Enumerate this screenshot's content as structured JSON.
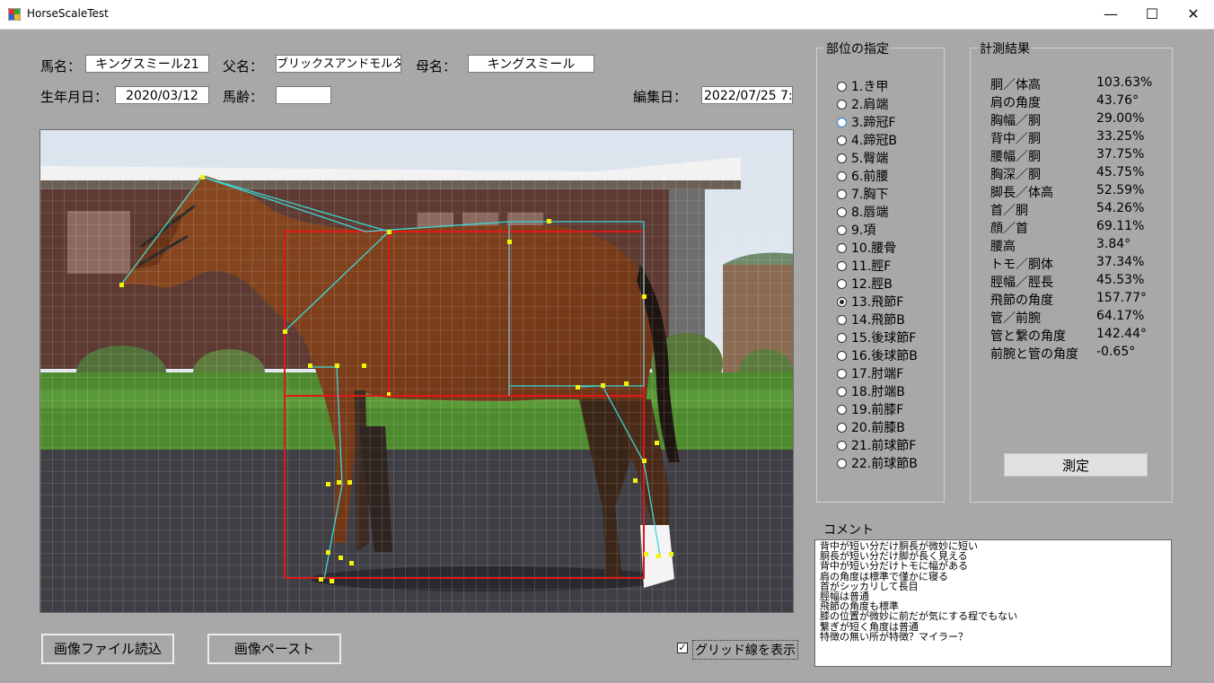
{
  "window": {
    "title": "HorseScaleTest",
    "minimize": "—",
    "maximize": "☐",
    "close": "✕"
  },
  "header": {
    "horse_name_label": "馬名：",
    "horse_name": "キングスミール21",
    "sire_label": "父名：",
    "sire": "ブリックスアンドモルタル",
    "dam_label": "母名：",
    "dam": "キングスミール",
    "birth_label": "生年月日：",
    "birth": "2020/03/12",
    "age_label": "馬齢：",
    "age": "",
    "edit_label": "編集日：",
    "edit_date": "2022/07/25 7:"
  },
  "parts": {
    "title": "部位の指定",
    "selected_index": 12,
    "highlighted_index": 2,
    "items": [
      "1.き甲",
      "2.肩端",
      "3.蹄冠F",
      "4.蹄冠B",
      "5.臀端",
      "6.前腰",
      "7.胸下",
      "8.唇端",
      "9.項",
      "10.腰骨",
      "11.脛F",
      "12.脛B",
      "13.飛節F",
      "14.飛節B",
      "15.後球節F",
      "16.後球節B",
      "17.肘端F",
      "18.肘端B",
      "19.前膝F",
      "20.前膝B",
      "21.前球節F",
      "22.前球節B"
    ]
  },
  "results": {
    "title": "計測結果",
    "items": [
      {
        "name": "胴／体高",
        "value": "103.63%"
      },
      {
        "name": "肩の角度",
        "value": "43.76°"
      },
      {
        "name": "胸幅／胴",
        "value": "29.00%"
      },
      {
        "name": "背中／胴",
        "value": "33.25%"
      },
      {
        "name": "腰幅／胴",
        "value": "37.75%"
      },
      {
        "name": "胸深／胴",
        "value": "45.75%"
      },
      {
        "name": "脚長／体高",
        "value": "52.59%"
      },
      {
        "name": "首／胴",
        "value": "54.26%"
      },
      {
        "name": "顔／首",
        "value": "69.11%"
      },
      {
        "name": "腰高",
        "value": "3.84°"
      },
      {
        "name": "トモ／胴体",
        "value": "37.34%"
      },
      {
        "name": "脛幅／脛長",
        "value": "45.53%"
      },
      {
        "name": "飛節の角度",
        "value": "157.77°"
      },
      {
        "name": "管／前腕",
        "value": "64.17%"
      },
      {
        "name": "管と繋の角度",
        "value": "142.44°"
      },
      {
        "name": "前腕と管の角度",
        "value": "-0.65°"
      }
    ],
    "measure_button": "測定"
  },
  "comment": {
    "label": "コメント",
    "lines": [
      "背中が短い分だけ胴長が微妙に短い",
      "胴長が短い分だけ脚が長く見える",
      "背中が短い分だけトモに幅がある",
      "肩の角度は標準で僅かに寝る",
      "首がシッカリして長目",
      "脛幅は普通",
      "飛節の角度も標準",
      "膝の位置が微妙に前だが気にする程でもない",
      "繋ぎが短く角度は普通",
      "特徴の無い所が特徴？マイラー？"
    ]
  },
  "buttons": {
    "load_image": "画像ファイル読込",
    "paste_image": "画像ペースト"
  },
  "grid_checkbox": {
    "label": "グリッド線を表示",
    "checked": true,
    "mark": "✓"
  },
  "colors": {
    "background": "#a8a8a8",
    "frame_red": "#e11818",
    "skeleton_cyan": "#3cd8d8",
    "marker_yellow": "#f2f20a"
  }
}
